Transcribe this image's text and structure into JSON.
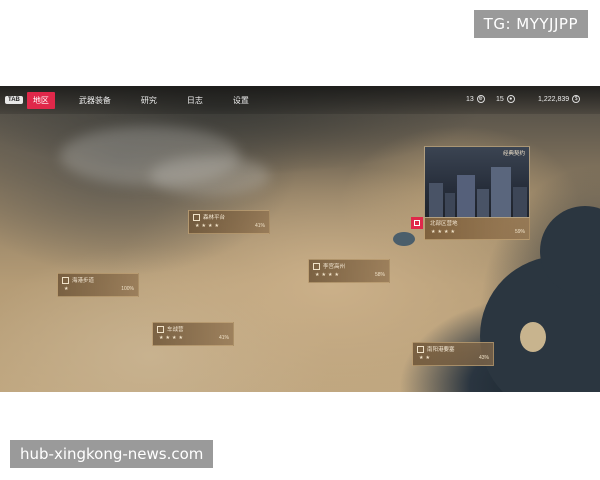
{
  "watermarks": {
    "top": "TG: MYYJJPP",
    "bottom": "hub-xingkong-news.com"
  },
  "topbar": {
    "tab_key": "TAB",
    "nav": [
      {
        "label": "地区",
        "active": true
      },
      {
        "label": "武器装备",
        "active": false
      },
      {
        "label": "研究",
        "active": false
      },
      {
        "label": "日志",
        "active": false
      },
      {
        "label": "设置",
        "active": false
      }
    ],
    "resources": [
      {
        "value": "13",
        "icon": "gear-icon"
      },
      {
        "value": "15",
        "icon": "coin-icon"
      },
      {
        "value": "1,222,839",
        "icon": "money-icon"
      }
    ]
  },
  "preview": {
    "title": "经典契约"
  },
  "regions": [
    {
      "name": "森林平台",
      "stars": "★★★★",
      "percent": "41%",
      "selected": false
    },
    {
      "name": "海港步道",
      "stars": "★",
      "percent": "100%",
      "selected": false
    },
    {
      "name": "李宫高州",
      "stars": "★★★★",
      "percent": "58%",
      "selected": false
    },
    {
      "name": "车战营",
      "stars": "★★★★",
      "percent": "41%",
      "selected": false
    },
    {
      "name": "北部区营地",
      "stars": "★★★★",
      "percent": "59%",
      "selected": true
    },
    {
      "name": "南阳港要塞",
      "stars": "★★",
      "percent": "43%",
      "selected": false
    }
  ]
}
